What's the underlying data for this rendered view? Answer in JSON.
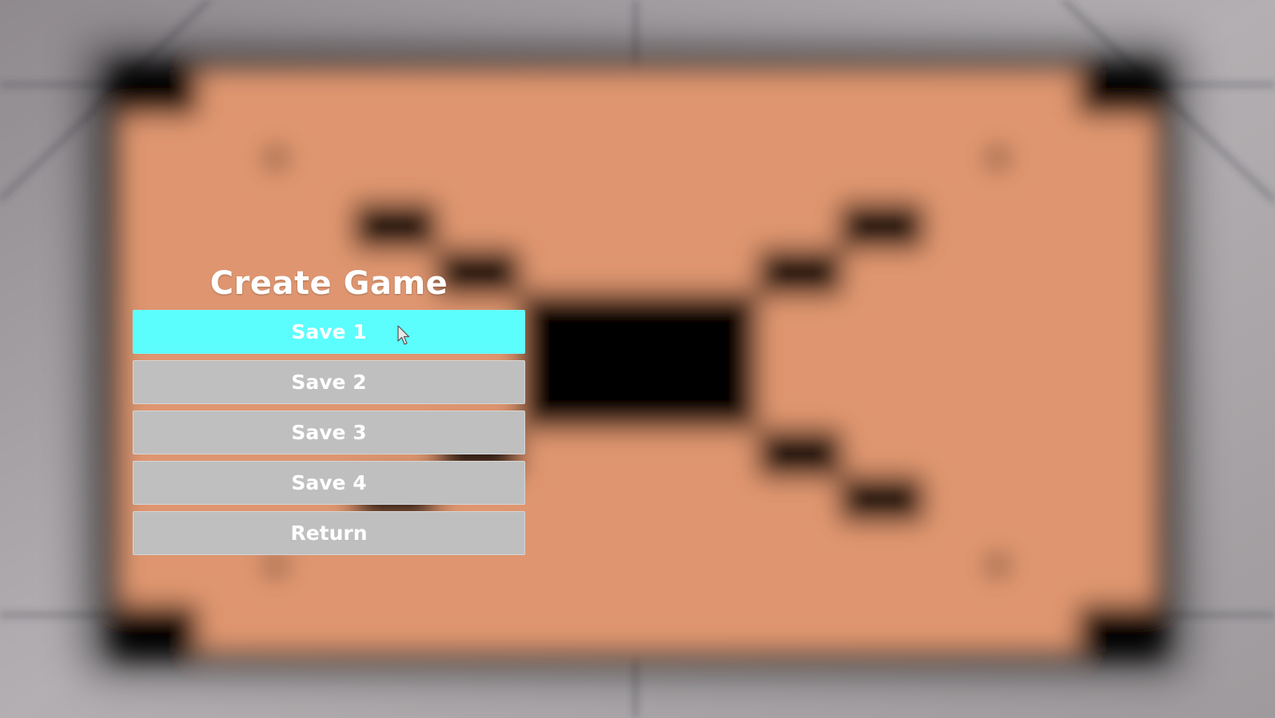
{
  "menu": {
    "title": "Create Game",
    "buttons": [
      {
        "label": "Save 1",
        "state": "highlighted"
      },
      {
        "label": "Save 2",
        "state": "normal"
      },
      {
        "label": "Save 3",
        "state": "normal"
      },
      {
        "label": "Save 4",
        "state": "normal"
      },
      {
        "label": "Return",
        "state": "normal"
      }
    ]
  },
  "colors": {
    "highlight": "#5bfdfd",
    "button": "#bfbfbf",
    "text": "#ffffff",
    "tile_orange": "#df9670",
    "tile_dark": "#000000",
    "floor": "#a7a3a6"
  },
  "icons": {
    "cursor": "mouse-pointer-icon"
  }
}
